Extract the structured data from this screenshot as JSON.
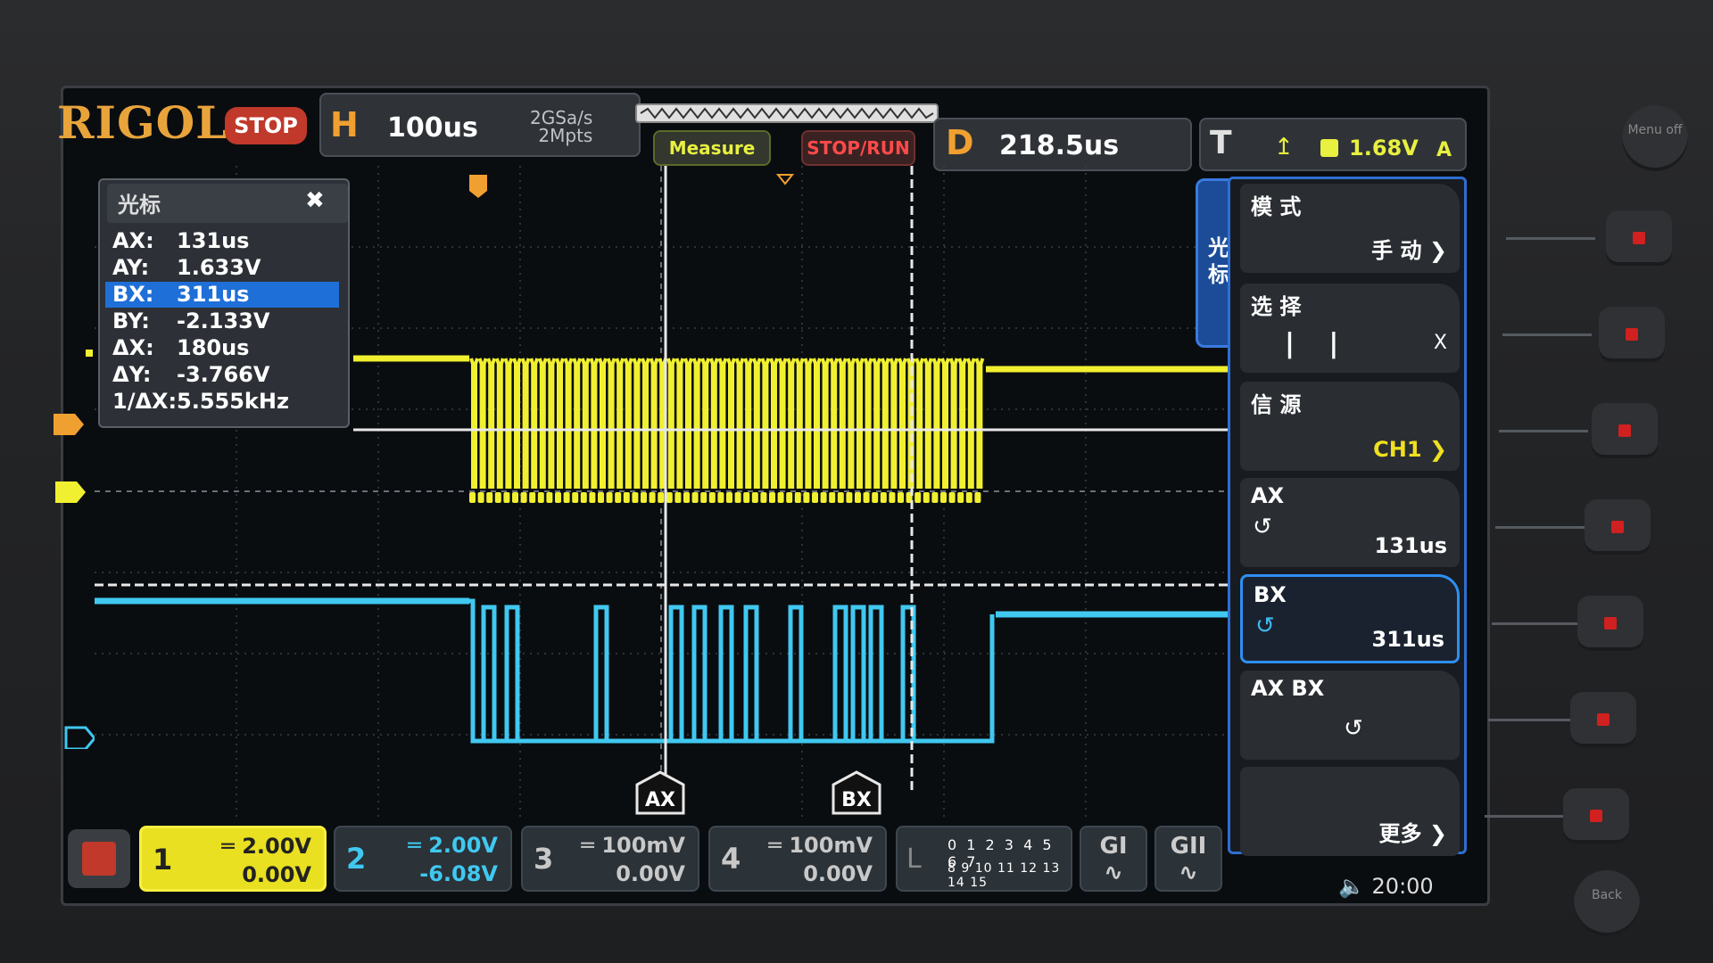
{
  "brand": "RIGOL",
  "run_state": "STOP",
  "horizontal": {
    "letter": "H",
    "timebase": "100us",
    "sample_rate": "2GSa/s",
    "memory_depth": "2Mpts"
  },
  "buttons": {
    "measure": "Measure",
    "stop_run": "STOP/RUN"
  },
  "delay": {
    "letter": "D",
    "value": "218.5us"
  },
  "trigger": {
    "letter": "T",
    "level": "1.68V",
    "mode": "A",
    "color": "#e8f040"
  },
  "cursor_panel": {
    "title": "光标",
    "rows": [
      {
        "key": "AX:",
        "value": "131us"
      },
      {
        "key": "AY:",
        "value": "1.633V"
      },
      {
        "key": "BX:",
        "value": "311us"
      },
      {
        "key": "BY:",
        "value": "-2.133V"
      },
      {
        "key": "ΔX:",
        "value": "180us"
      },
      {
        "key": "ΔY:",
        "value": "-3.766V"
      },
      {
        "key": "1/ΔX:",
        "value": "5.555kHz"
      }
    ],
    "selected_row": "BX:"
  },
  "cursor_markers": {
    "a": "AX",
    "b": "BX"
  },
  "menu": {
    "tab": "光标",
    "items": [
      {
        "label": "模 式",
        "value": "手 动"
      },
      {
        "label": "选 择",
        "value": "X"
      },
      {
        "label": "信 源",
        "value": "CH1"
      },
      {
        "label": "AX",
        "value": "131us"
      },
      {
        "label": "BX",
        "value": "311us"
      },
      {
        "label": "AX BX",
        "value": ""
      },
      {
        "label": "",
        "value": "更多"
      }
    ]
  },
  "channels": [
    {
      "num": "1",
      "scale": "2.00V",
      "offset": "0.00V",
      "color": "#e8e020"
    },
    {
      "num": "2",
      "scale": "2.00V",
      "offset": "-6.08V",
      "color": "#40c8f0"
    },
    {
      "num": "3",
      "scale": "100mV",
      "offset": "0.00V",
      "color": "#c8c8c8"
    },
    {
      "num": "4",
      "scale": "100mV",
      "offset": "0.00V",
      "color": "#c8c8c8"
    }
  ],
  "logic": {
    "label": "L",
    "row1": "0 1 2 3 4 5 6 7",
    "row2": "8 9 10 11 12 13 14 15"
  },
  "generators": [
    {
      "label": "GI"
    },
    {
      "label": "GII"
    }
  ],
  "clock": "20:00",
  "hardware": {
    "menu_off": "Menu off",
    "back": "Back"
  }
}
